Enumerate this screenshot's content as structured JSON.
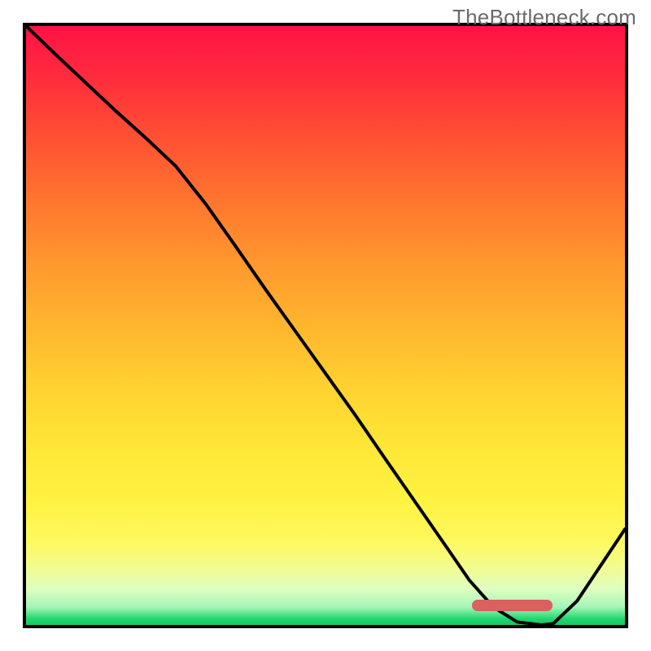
{
  "watermark": "TheBottleneck.com",
  "colors": {
    "curve_stroke": "#000000",
    "marker_fill": "#db6060",
    "border": "#000000"
  },
  "marker": {
    "x_frac": 0.744,
    "width_frac": 0.135,
    "y_from_bottom_frac": 0.033
  },
  "chart_data": {
    "type": "line",
    "title": "",
    "xlabel": "",
    "ylabel": "",
    "xlim": [
      0,
      1
    ],
    "ylim": [
      0,
      1
    ],
    "series": [
      {
        "name": "curve",
        "x": [
          0.0,
          0.05,
          0.1,
          0.15,
          0.2,
          0.25,
          0.3,
          0.35,
          0.4,
          0.45,
          0.5,
          0.55,
          0.6,
          0.65,
          0.7,
          0.74,
          0.78,
          0.82,
          0.86,
          0.88,
          0.92,
          0.96,
          1.0
        ],
        "y": [
          1.0,
          0.952,
          0.905,
          0.858,
          0.813,
          0.766,
          0.703,
          0.632,
          0.56,
          0.49,
          0.42,
          0.35,
          0.277,
          0.205,
          0.133,
          0.075,
          0.03,
          0.005,
          0.0,
          0.002,
          0.04,
          0.1,
          0.16
        ]
      }
    ]
  }
}
